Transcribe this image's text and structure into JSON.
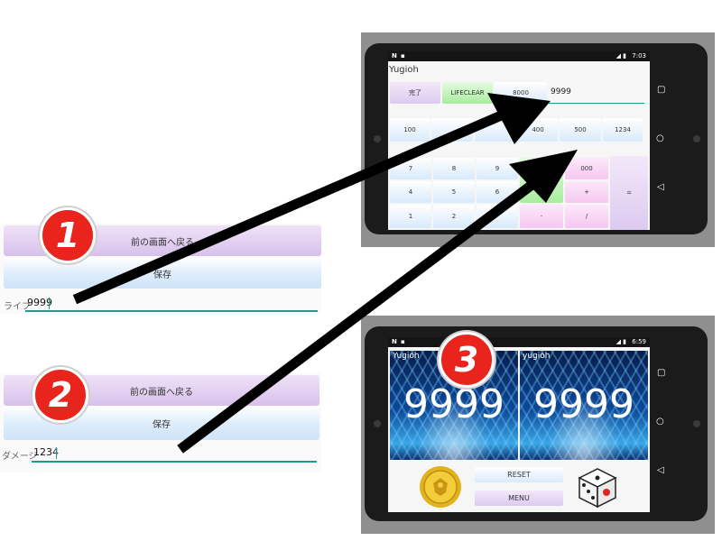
{
  "snippet1": {
    "back_button": "前の画面へ戻る",
    "save_button": "保存",
    "field_label": "ライフ",
    "field_value": "9999"
  },
  "snippet2": {
    "back_button": "前の画面へ戻る",
    "save_button": "保存",
    "field_label": "ダメージ",
    "field_value": "1234"
  },
  "badges": [
    "1",
    "2",
    "3"
  ],
  "phone_top": {
    "status_time": "7:03",
    "status_left": "N",
    "app_title": "Yugioh",
    "toolbar": {
      "done_label": "完了",
      "lifeclear_label": "LIFECLEAR",
      "value_8000_label": "8000",
      "life_display": "9999"
    },
    "presets": [
      "100",
      "400",
      "500",
      "1234"
    ],
    "keypad": {
      "row1": [
        "7",
        "8",
        "9",
        "000"
      ],
      "row2": [
        "4",
        "5",
        "6",
        "+",
        "="
      ],
      "row3": [
        "1",
        "2",
        "-",
        "/"
      ]
    }
  },
  "phone_bottom": {
    "status_time": "6:59",
    "status_left": "N",
    "player1_name": "Yugioh",
    "player1_life": "9999",
    "player2_name": "yugioh",
    "player2_life": "9999",
    "reset_label": "RESET",
    "menu_label": "MENU"
  },
  "colors": {
    "badge": "#e8241c",
    "field_underline": "#1e9b8a",
    "button_purple": "#d7c1ec",
    "button_blue": "#cfe4f8"
  }
}
